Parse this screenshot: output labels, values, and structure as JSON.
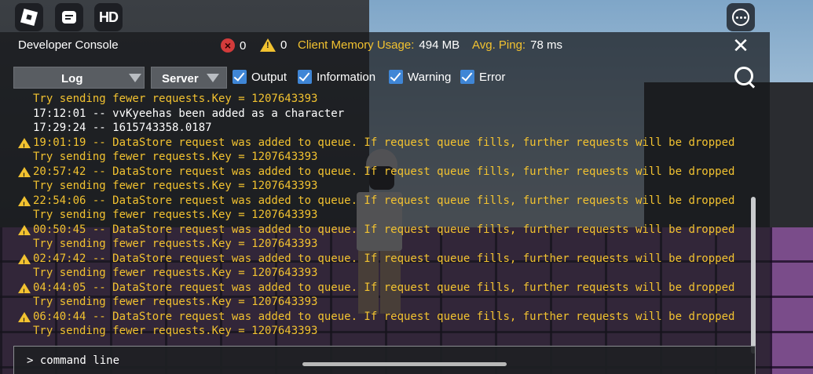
{
  "header": {
    "title": "Developer Console",
    "error_count": "0",
    "warning_count": "0",
    "memory_label": "Client Memory Usage:",
    "memory_value": "494 MB",
    "ping_label": "Avg. Ping:",
    "ping_value": "78 ms"
  },
  "controls": {
    "view_dropdown": "Log",
    "context_dropdown": "Server",
    "filters": [
      {
        "label": "Output",
        "checked": true
      },
      {
        "label": "Information",
        "checked": true
      },
      {
        "label": "Warning",
        "checked": true
      },
      {
        "label": "Error",
        "checked": true
      }
    ]
  },
  "top_icons": [
    "roblox-logo-icon",
    "chat-icon",
    "hd-icon"
  ],
  "hd_label": "HD",
  "log_lines": [
    {
      "type": "warning-cont",
      "text": "Try sending fewer requests.Key = 1207643393"
    },
    {
      "type": "output",
      "text": "17:12:01 -- vvKyeehas been added as a character"
    },
    {
      "type": "output",
      "text": "17:29:24 -- 1615743358.0187"
    },
    {
      "type": "warning",
      "text": "19:01:19 -- DataStore request was added to queue. If request queue fills, further requests will be dropped"
    },
    {
      "type": "warning-cont",
      "text": "Try sending fewer requests.Key = 1207643393"
    },
    {
      "type": "warning",
      "text": "20:57:42 -- DataStore request was added to queue. If request queue fills, further requests will be dropped"
    },
    {
      "type": "warning-cont",
      "text": "Try sending fewer requests.Key = 1207643393"
    },
    {
      "type": "warning",
      "text": "22:54:06 -- DataStore request was added to queue. If request queue fills, further requests will be dropped"
    },
    {
      "type": "warning-cont",
      "text": "Try sending fewer requests.Key = 1207643393"
    },
    {
      "type": "warning",
      "text": "00:50:45 -- DataStore request was added to queue. If request queue fills, further requests will be dropped"
    },
    {
      "type": "warning-cont",
      "text": "Try sending fewer requests.Key = 1207643393"
    },
    {
      "type": "warning",
      "text": "02:47:42 -- DataStore request was added to queue. If request queue fills, further requests will be dropped"
    },
    {
      "type": "warning-cont",
      "text": "Try sending fewer requests.Key = 1207643393"
    },
    {
      "type": "warning",
      "text": "04:44:05 -- DataStore request was added to queue. If request queue fills, further requests will be dropped"
    },
    {
      "type": "warning-cont",
      "text": "Try sending fewer requests.Key = 1207643393"
    },
    {
      "type": "warning",
      "text": "06:40:44 -- DataStore request was added to queue. If request queue fills, further requests will be dropped"
    },
    {
      "type": "warning-cont",
      "text": "Try sending fewer requests.Key = 1207643393"
    }
  ],
  "command_line": {
    "prompt": "> command line"
  },
  "colors": {
    "warning": "#f2c230",
    "error": "#d23b3b",
    "checkbox": "#3f86d6"
  }
}
